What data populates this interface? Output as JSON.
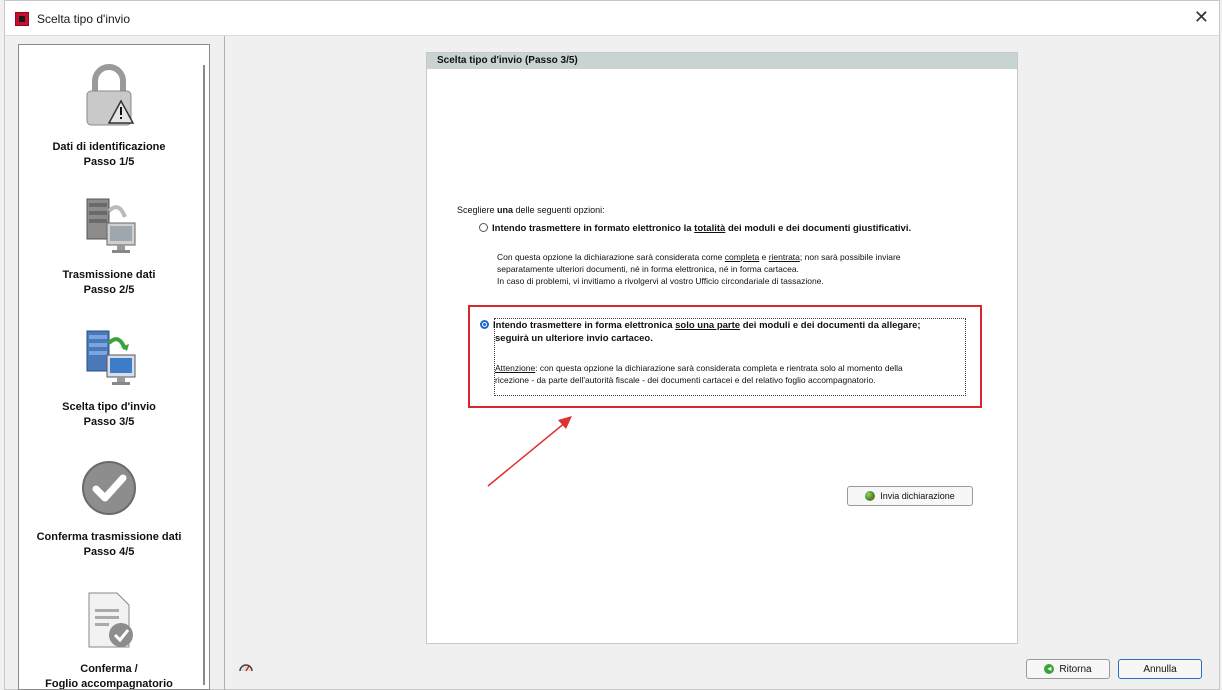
{
  "window": {
    "title": "Scelta tipo d'invio"
  },
  "sidebar": {
    "steps": [
      {
        "name": "Dati di identificazione",
        "step": "Passo 1/5",
        "icon": "lock-warning-icon"
      },
      {
        "name": "Trasmissione dati",
        "step": "Passo 2/5",
        "icon": "server-transfer-icon"
      },
      {
        "name": "Scelta tipo d'invio",
        "step": "Passo 3/5",
        "icon": "server-send-icon"
      },
      {
        "name": "Conferma trasmissione dati",
        "step": "Passo 4/5",
        "icon": "checkmark-circle-icon"
      },
      {
        "name": "Conferma /",
        "step": "Foglio accompagnatorio",
        "icon": "document-check-icon"
      }
    ]
  },
  "panel": {
    "header": "Scelta tipo d'invio (Passo 3/5)",
    "intro_pre": "Scegliere ",
    "intro_bold": "una",
    "intro_post": " delle seguenti opzioni:",
    "option1": {
      "pre": "Intendo trasmettere in formato elettronico la ",
      "underline": "totalità",
      "post": " dei moduli e dei documenti giustificativi.",
      "selected": false,
      "desc_pre": "Con questa opzione la dichiarazione sarà considerata come ",
      "desc_u1": "completa",
      "desc_mid": " e ",
      "desc_u2": "rientrata",
      "desc_post": "; non sarà possibile inviare",
      "desc_line2": "separatamente ulteriori documenti, né in forma elettronica, né in forma cartacea.",
      "desc_line3": "In caso di problemi, vi invitiamo a rivolgervi al vostro Ufficio circondariale di tassazione."
    },
    "option2": {
      "pre": "Intendo trasmettere in forma elettronica ",
      "underline": "solo una parte",
      "post": " dei moduli e dei documenti da allegare;",
      "line2": "seguirà un ulteriore invio cartaceo.",
      "selected": true,
      "desc_u": "Attenzione",
      "desc_post": ": con questa opzione la dichiarazione sarà considerata completa e rientrata solo al momento della",
      "desc_line2": "ricezione - da parte dell'autorità fiscale - dei documenti cartacei e del relativo foglio accompagnatorio."
    },
    "send_button": "Invia dichiarazione"
  },
  "footer": {
    "back_button": "Ritorna",
    "cancel_button": "Annulla"
  },
  "colors": {
    "highlight": "#d8262e",
    "header_bg": "#c8d4d4",
    "accent": "#2d6cc0"
  }
}
